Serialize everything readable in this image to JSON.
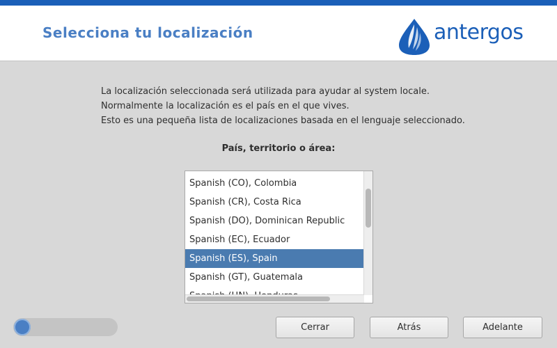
{
  "header": {
    "title": "Selecciona tu localización",
    "logo_text": "antergos"
  },
  "description": {
    "line1": "La localización seleccionada será utilizada para ayudar al system locale.",
    "line2": "Normalmente la localización es el país en el que vives.",
    "line3": "Esto es una pequeña lista de localizaciones basada en el lenguaje seleccionado."
  },
  "locale_list": {
    "label": "País, territorio o área:",
    "items": [
      "Spanish (CO), Colombia",
      "Spanish (CR), Costa Rica",
      "Spanish (DO), Dominican Republic",
      "Spanish (EC), Ecuador",
      "Spanish (ES), Spain",
      "Spanish (GT), Guatemala",
      "Spanish (HN), Honduras"
    ],
    "selected": "Spanish (ES), Spain"
  },
  "progress": {
    "value": 0.12
  },
  "buttons": {
    "close": "Cerrar",
    "back": "Atrás",
    "forward": "Adelante"
  },
  "colors": {
    "accent": "#4a7fc4",
    "brand": "#1b5fb8",
    "selection": "#4a7bb0"
  }
}
